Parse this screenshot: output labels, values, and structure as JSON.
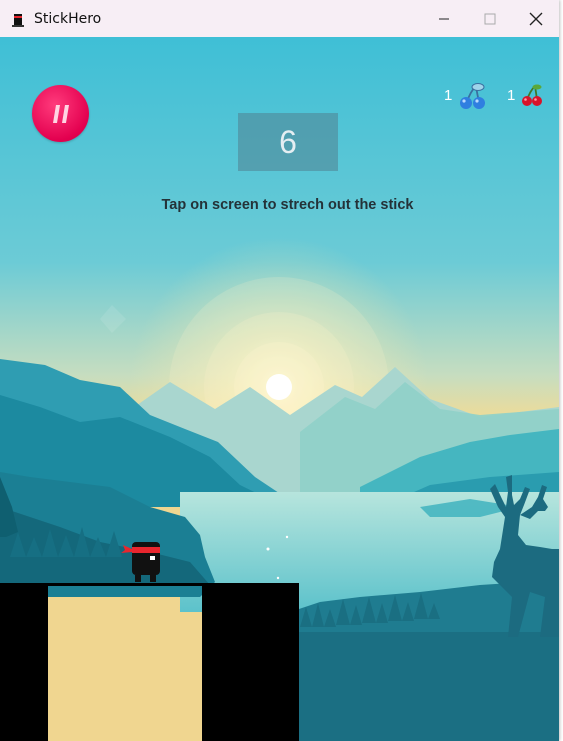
{
  "window": {
    "title": "StickHero",
    "controls": {
      "minimize": "minimize-icon",
      "maximize": "maximize-icon",
      "close": "close-icon"
    }
  },
  "hud": {
    "pause_icon": "pause-icon",
    "score": "6",
    "hint": "Tap on screen to strech out the stick",
    "collectibles": [
      {
        "name": "blue-cherry",
        "count": "1",
        "icon": "blue-cherry-icon"
      },
      {
        "name": "red-cherry",
        "count": "1",
        "icon": "red-cherry-icon"
      }
    ]
  },
  "colors": {
    "pause_button": "#e3004f",
    "score_box": "#5a8a97",
    "platform": "#000000",
    "headband": "#e8262e"
  }
}
